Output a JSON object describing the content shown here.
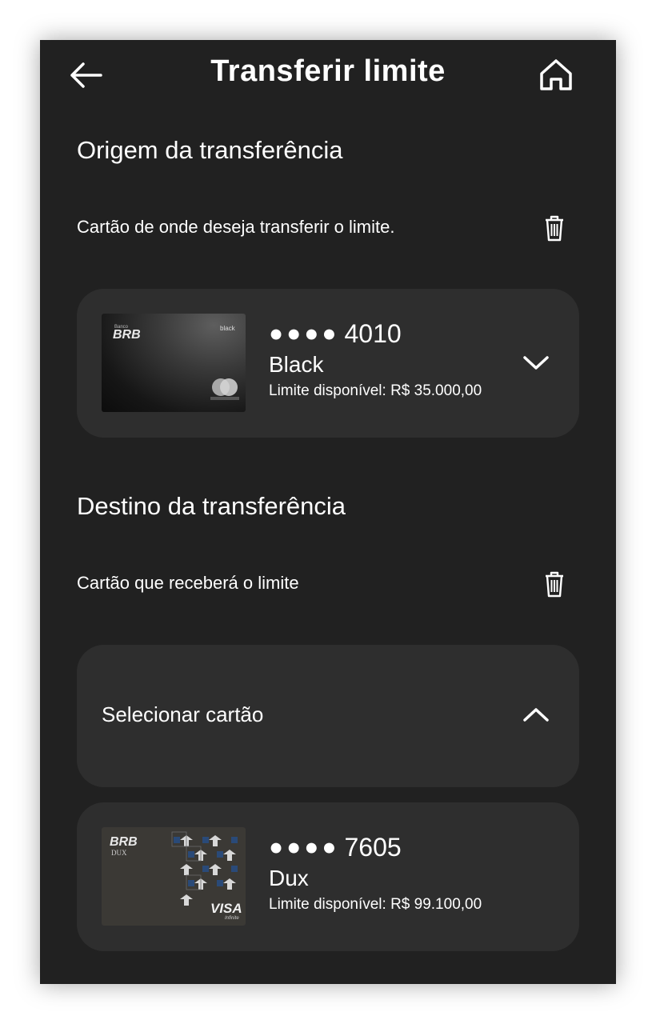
{
  "header": {
    "title": "Transferir limite",
    "back_icon": "arrow-left-icon",
    "home_icon": "home-icon"
  },
  "origin": {
    "title": "Origem da transferência",
    "subtitle": "Cartão de onde deseja transferir o limite.",
    "delete_icon": "trash-icon",
    "card": {
      "masked_dots": "●●●●",
      "last4": "4010",
      "name": "Black",
      "limit": "Limite disponível: R$ 35.000,00",
      "brand_logo": "BRB",
      "brand_small": "Banco",
      "tier": "black",
      "network": "mastercard-logo",
      "network_sub": "mastercard",
      "chevron_icon": "chevron-down-icon"
    }
  },
  "destination": {
    "title": "Destino da transferência",
    "subtitle": "Cartão que receberá o limite",
    "delete_icon": "trash-icon",
    "select_label": "Selecionar cartão",
    "select_chevron_icon": "chevron-up-icon",
    "option": {
      "masked_dots": "●●●●",
      "last4": "7605",
      "name": "Dux",
      "limit": "Limite disponível: R$ 99.100,00",
      "brand_logo": "BRB",
      "brand_sub": "DUX",
      "network": "VISA",
      "network_sub": "Infinite"
    }
  },
  "colors": {
    "background": "#212121",
    "panel": "#2e2e2e",
    "text": "#ffffff"
  }
}
